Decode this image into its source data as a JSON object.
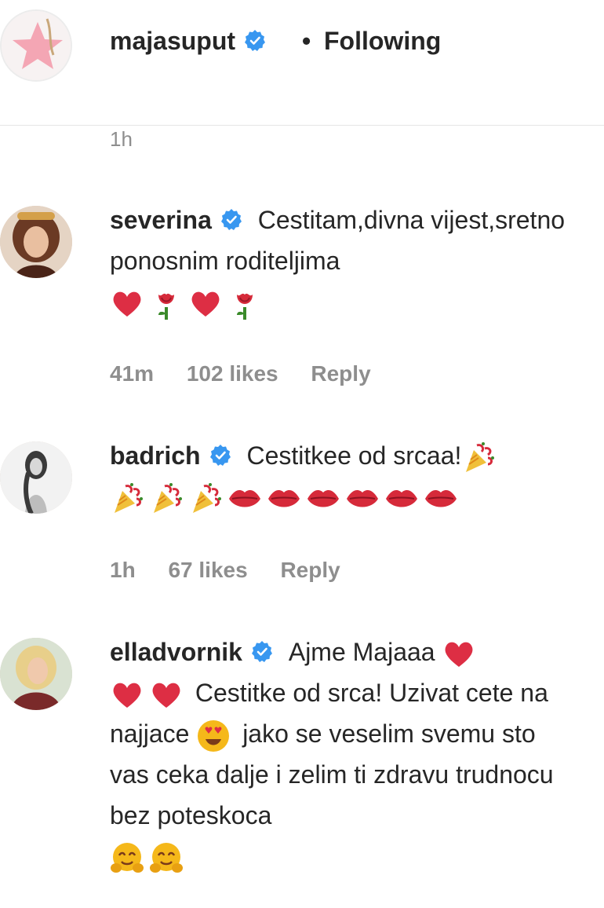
{
  "post_author": {
    "username": "majasuput",
    "separator": "•",
    "follow_label": "Following",
    "time": "1h"
  },
  "comments": [
    {
      "username": "severina",
      "text": "Cestitam,divna vijest,sretno ponosnim roditeljima",
      "emojis": [
        "heart",
        "rose",
        "heart",
        "rose"
      ],
      "time": "41m",
      "likes": "102 likes",
      "reply": "Reply"
    },
    {
      "username": "badrich",
      "text": "Cestitkee od srcaa!",
      "emojis": [
        "party-popper",
        "party-popper",
        "party-popper",
        "party-popper",
        "red-lips",
        "red-lips",
        "red-lips",
        "red-lips",
        "red-lips",
        "red-lips"
      ],
      "time": "1h",
      "likes": "67 likes",
      "reply": "Reply"
    },
    {
      "username": "elladvornik",
      "text_1": "Ajme Majaaa",
      "text_2": "Cestitke od srca! Uzivat cete na najjace",
      "text_3": "jako se veselim svemu sto vas ceka dalje i zelim ti zdravu trudnocu bez poteskoca",
      "emojis": [
        "heart",
        "heart",
        "heart",
        "heart-eyes",
        "hugging-face",
        "hugging-face"
      ]
    }
  ],
  "colors": {
    "verified_blue": "#3897f0",
    "muted_text": "#8e8e8e",
    "heart_red": "#dd2e44"
  }
}
